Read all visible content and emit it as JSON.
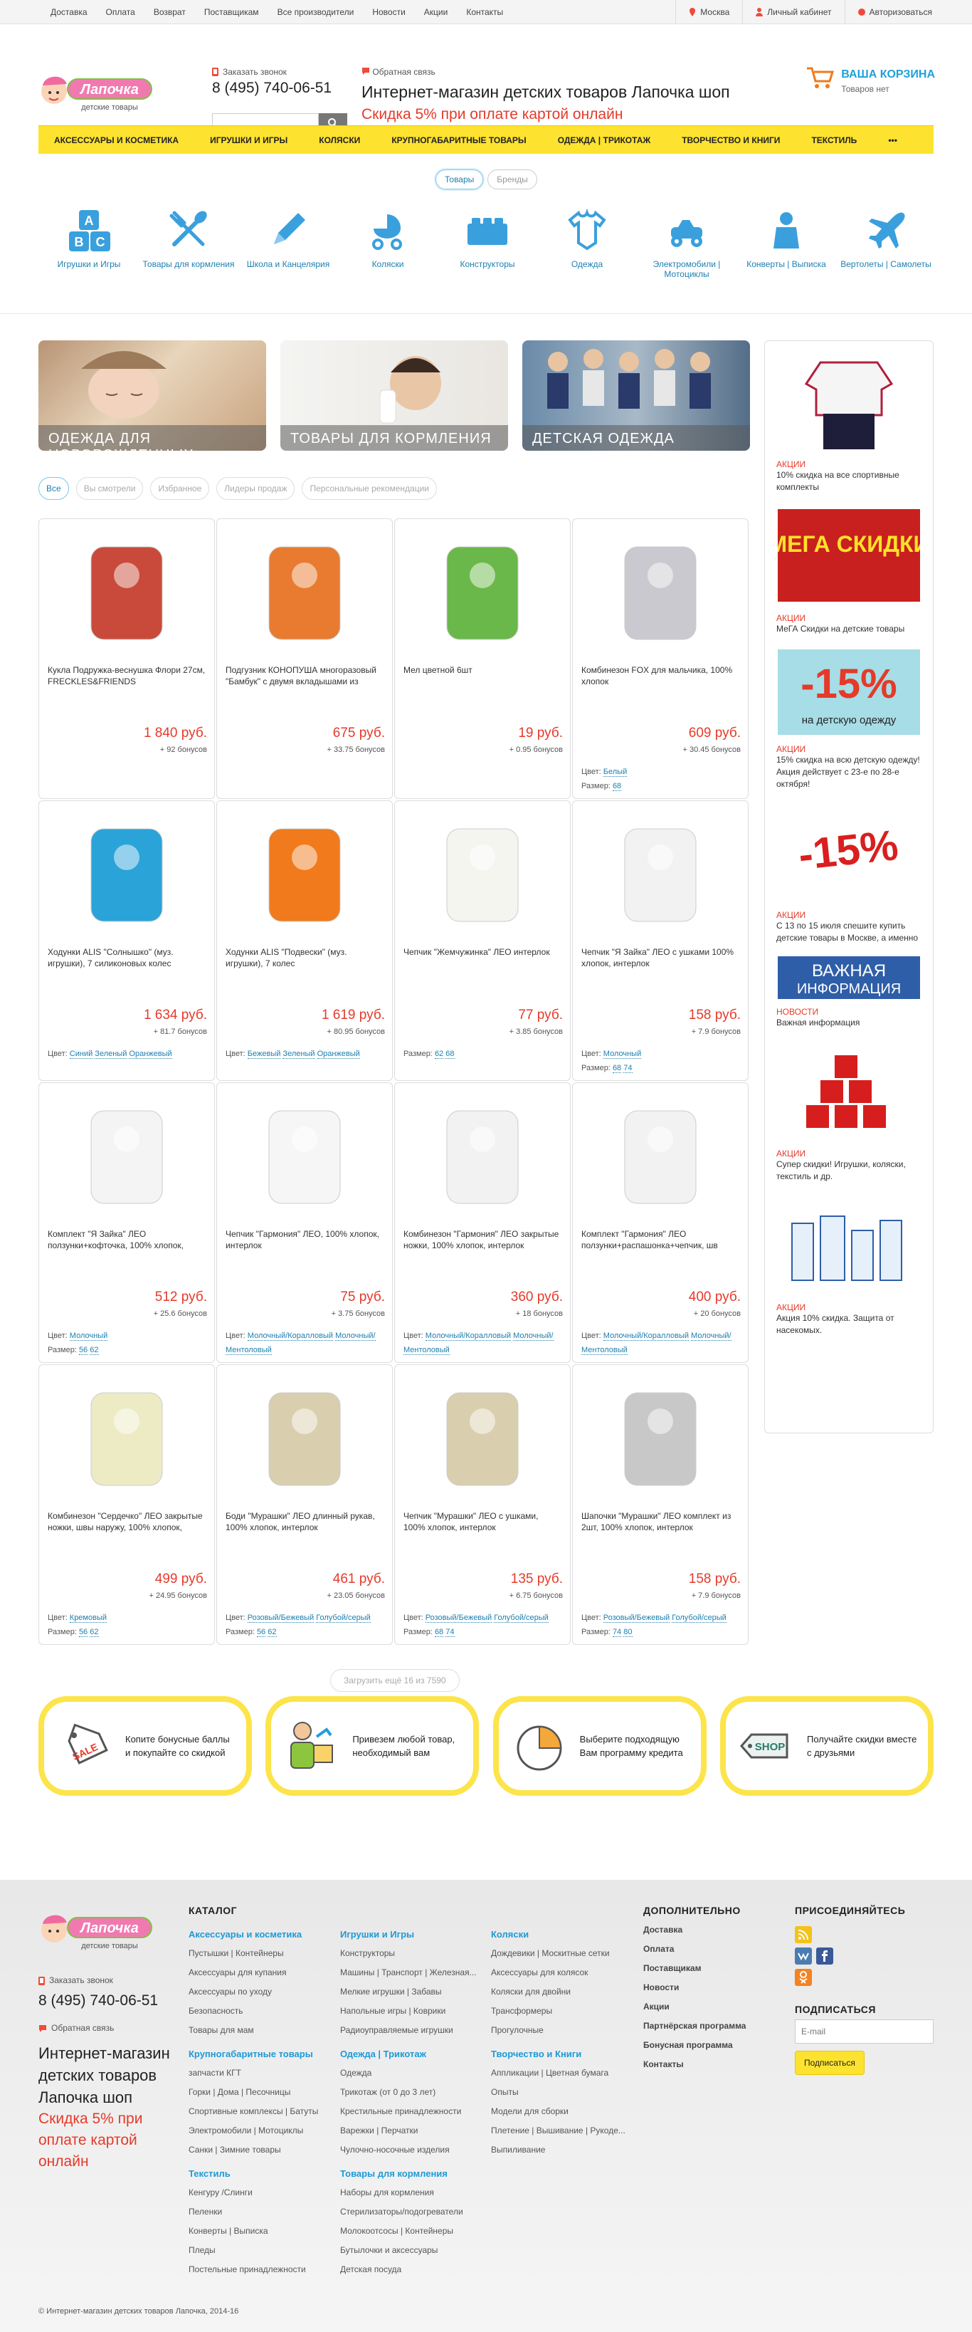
{
  "topnav": [
    "Доставка",
    "Оплата",
    "Возврат",
    "Поставщикам",
    "Все производители",
    "Новости",
    "Акции",
    "Контакты"
  ],
  "topright": {
    "city": "Москва",
    "cabinet": "Личный кабинет",
    "login": "Авторизоваться"
  },
  "header": {
    "callback": "Заказать звонок",
    "phone": "8 (495) 740-06-51",
    "feedback": "Обратная связь",
    "title": "Интернет-магазин детских товаров Лапочка шоп",
    "discount": "Скидка 5% при оплате картой онлайн",
    "logo": "Лапочка",
    "logo_sub": "детские товары",
    "cart_title": "ВАША КОРЗИНА",
    "cart_status": "Товаров нет"
  },
  "mainnav": [
    "Аксессуары и косметика",
    "Игрушки и игры",
    "Коляски",
    "Крупногабаритные товары",
    "Одежда | Трикотаж",
    "Творчество и книги",
    "Текстиль",
    "•••"
  ],
  "toggle": [
    "Товары",
    "Бренды"
  ],
  "categories": [
    "Игрушки и Игры",
    "Товары для кормления",
    "Школа и Канцелярия",
    "Коляски",
    "Конструкторы",
    "Одежда",
    "Электромобили | Мотоциклы",
    "Конверты | Выписка",
    "Вертолеты | Самолеты"
  ],
  "banners": [
    "Одежда для новорожденных",
    "Товары для кормления",
    "Детская одежда"
  ],
  "filters": [
    "Все",
    "Вы смотрели",
    "Избранное",
    "Лидеры продаж",
    "Персональные рекомендации"
  ],
  "products": [
    {
      "name": "Кукла Подружка-веснушка Флори 27см, FRECKLES&FRIENDS",
      "price": "1 840 руб.",
      "bonus": "+ 92 бонусов",
      "color": "#c94a3a"
    },
    {
      "name": "Подгузник КОНОПУША многоразовый \"Бамбук\" с двумя вкладышами из",
      "price": "675 руб.",
      "bonus": "+ 33.75 бонусов",
      "color": "#e87b30"
    },
    {
      "name": "Мел цветной 6шт",
      "price": "19 руб.",
      "bonus": "+ 0.95 бонусов",
      "color": "#6ab84a"
    },
    {
      "name": "Комбинезон FOX для мальчика, 100% хлопок",
      "price": "609 руб.",
      "bonus": "+ 30.45 бонусов",
      "color": "#c9c9cf",
      "cl": "Цвет:",
      "cv": [
        "Белый"
      ],
      "sl": "Размер:",
      "sv": [
        "68"
      ]
    },
    {
      "name": "Ходунки ALIS \"Солнышко\" (муз. игрушки), 7 силиконовых колес",
      "price": "1 634 руб.",
      "bonus": "+ 81.7 бонусов",
      "color": "#2aa3d9",
      "cl": "Цвет:",
      "cv": [
        "Синий",
        "Зеленый",
        "Оранжевый"
      ]
    },
    {
      "name": "Ходунки ALIS \"Подвески\" (муз. игрушки), 7 колес",
      "price": "1 619 руб.",
      "bonus": "+ 80.95 бонусов",
      "color": "#f07a1c",
      "cl": "Цвет:",
      "cv": [
        "Бежевый",
        "Зеленый",
        "Оранжевый"
      ]
    },
    {
      "name": "Чепчик \"Жемчужинка\" ЛЕО интерлок",
      "price": "77 руб.",
      "bonus": "+ 3.85 бонусов",
      "color": "#f5f5f0",
      "sl": "Размер:",
      "sv": [
        "62",
        "68"
      ]
    },
    {
      "name": "Чепчик \"Я Зайка\" ЛЕО с ушками 100% хлопок, интерлок",
      "price": "158 руб.",
      "bonus": "+ 7.9 бонусов",
      "color": "#f2f2f2",
      "cl": "Цвет:",
      "cv": [
        "Молочный"
      ],
      "sl": "Размер:",
      "sv": [
        "68",
        "74"
      ]
    },
    {
      "name": "Комплект \"Я Зайка\" ЛЕО ползунки+кофточка, 100% хлопок,",
      "price": "512 руб.",
      "bonus": "+ 25.6 бонусов",
      "color": "#f4f4f4",
      "cl": "Цвет:",
      "cv": [
        "Молочный"
      ],
      "sl": "Размер:",
      "sv": [
        "56",
        "62"
      ]
    },
    {
      "name": "Чепчик \"Гармония\" ЛЕО, 100% хлопок, интерлок",
      "price": "75 руб.",
      "bonus": "+ 3.75 бонусов",
      "color": "#f6f6f6",
      "cl": "Цвет:",
      "cv": [
        "Молочный/Коралловый",
        "Молочный/Ментоловый"
      ]
    },
    {
      "name": "Комбинезон \"Гармония\" ЛЕО закрытые ножки, 100% хлопок, интерлок",
      "price": "360 руб.",
      "bonus": "+ 18 бонусов",
      "color": "#f2f2f2",
      "cl": "Цвет:",
      "cv": [
        "Молочный/Коралловый",
        "Молочный/Ментоловый"
      ]
    },
    {
      "name": "Комплект \"Гармония\" ЛЕО ползунки+распашонка+чепчик, шв",
      "price": "400 руб.",
      "bonus": "+ 20 бонусов",
      "color": "#f2f2f2",
      "cl": "Цвет:",
      "cv": [
        "Молочный/Коралловый",
        "Молочный/Ментоловый"
      ]
    },
    {
      "name": "Комбинезон \"Сердечко\" ЛЕО закрытые ножки, швы наружу, 100% хлопок,",
      "price": "499 руб.",
      "bonus": "+ 24.95 бонусов",
      "color": "#ecebc4",
      "cl": "Цвет:",
      "cv": [
        "Кремовый"
      ],
      "sl": "Размер:",
      "sv": [
        "56",
        "62"
      ]
    },
    {
      "name": "Боди \"Мурашки\" ЛЕО длинный рукав, 100% хлопок, интерлок",
      "price": "461 руб.",
      "bonus": "+ 23.05 бонусов",
      "color": "#d9cfae",
      "cl": "Цвет:",
      "cv": [
        "Розовый/Бежевый",
        "Голубой/серый"
      ],
      "sl": "Размер:",
      "sv": [
        "56",
        "62"
      ]
    },
    {
      "name": "Чепчик \"Мурашки\" ЛЕО с ушками, 100% хлопок, интерлок",
      "price": "135 руб.",
      "bonus": "+ 6.75 бонусов",
      "color": "#d9cfae",
      "cl": "Цвет:",
      "cv": [
        "Розовый/Бежевый",
        "Голубой/серый"
      ],
      "sl": "Размер:",
      "sv": [
        "68",
        "74"
      ]
    },
    {
      "name": "Шапочки \"Мурашки\" ЛЕО комплект из 2шт, 100% хлопок, интерлок",
      "price": "158 руб.",
      "bonus": "+ 7.9 бонусов",
      "color": "#c8c8c8",
      "cl": "Цвет:",
      "cv": [
        "Розовый/Бежевый",
        "Голубой/серый"
      ],
      "sl": "Размер:",
      "sv": [
        "74",
        "80"
      ]
    }
  ],
  "load_more": "Загрузить ещё 16 из 7590",
  "sidebar": [
    {
      "type": "Акции",
      "text": "10% скидка на все спортивные комплекты"
    },
    {
      "type": "Акции",
      "text": "МеГА Скидки на детские товары",
      "img": "МЕГА СКИДКИ"
    },
    {
      "type": "Акции",
      "text": "15% скидка на всю детскую одежду! Акция действует с 23-е по 28-е октября!",
      "img": "-15%",
      "img2": "на детскую одежду"
    },
    {
      "type": "Акции",
      "text": "С 13 по 15 июля спешите купить детские товары в Москве, а именно",
      "img": "-15%"
    },
    {
      "type": "Новости",
      "text": "Важная информация",
      "img": "ВАЖНАЯ",
      "img2": "ИНФОРМАЦИЯ"
    },
    {
      "type": "Акции",
      "text": "Супер скидки! Игрушки, коляски, текстиль и др."
    },
    {
      "type": "Акции",
      "text": "Акция 10% скидка. Защита от насекомых."
    }
  ],
  "features": [
    "Копите бонусные баллы и покупайте со скидкой",
    "Привезем любой товар, необходимый вам",
    "Выберите подходящую Вам программу кредита",
    "Получайте скидки вместе с друзьями"
  ],
  "feature_icon_text": [
    "SALE",
    "SHOP"
  ],
  "footer": {
    "catalog_title": "Каталог",
    "col1": [
      {
        "h": "Аксессуары и косметика",
        "items": [
          "Пустышки | Контейнеры",
          "Аксессуары для купания",
          "Аксессуары по уходу",
          "Безопасность",
          "Товары для мам"
        ]
      },
      {
        "h": "Крупногабаритные товары",
        "items": [
          "запчасти КГТ",
          "Горки | Дома | Песочницы",
          "Спортивные комплексы | Батуты",
          "Электромобили | Мотоциклы",
          "Санки | Зимние товары"
        ]
      },
      {
        "h": "Текстиль",
        "items": [
          "Кенгуру /Слинги",
          "Пеленки",
          "Конверты | Выписка",
          "Пледы",
          "Постельные принадлежности"
        ]
      }
    ],
    "col2": [
      {
        "h": "Игрушки и Игры",
        "items": [
          "Конструкторы",
          "Машины | Транспорт | Железная...",
          "Мелкие игрушки | Забавы",
          "Напольные игры | Коврики",
          "Радиоуправляемые игрушки"
        ]
      },
      {
        "h": "Одежда | Трикотаж",
        "items": [
          "Одежда",
          "Трикотаж (от 0 до 3 лет)",
          "Крестильные принадлежности",
          "Варежки | Перчатки",
          "Чулочно-носочные изделия"
        ]
      },
      {
        "h": "Товары для кормления",
        "items": [
          "Наборы для кормления",
          "Стерилизаторы/подогреватели",
          "Молокоотсосы | Контейнеры",
          "Бутылочки и аксессуары",
          "Детская посуда"
        ]
      }
    ],
    "col3": [
      {
        "h": "Коляски",
        "items": [
          "Дождевики | Москитные сетки",
          "Аксессуары для колясок",
          "Коляски для двойни",
          "Трансформеры",
          "Прогулочные"
        ]
      },
      {
        "h": "Творчество и Книги",
        "items": [
          "Аппликации | Цветная бумага",
          "Опыты",
          "Модели для сборки",
          "Плетение | Вышивание | Рукоде...",
          "Выпиливание"
        ]
      }
    ],
    "extra_title": "Дополнительно",
    "extra": [
      "Доставка",
      "Оплата",
      "Поставщикам",
      "Новости",
      "Акции",
      "Партнёрская программа",
      "Бонусная программа",
      "Контакты"
    ],
    "join_title": "Присоединяйтесь",
    "subscribe_title": "Подписаться",
    "email_placeholder": "E-mail",
    "subscribe_btn": "Подписаться",
    "copyright": "© Интернет-магазин детских товаров Лапочка, 2014-16"
  },
  "colors": {
    "accent": "#fde32f",
    "link": "#1e7fb0",
    "price": "#e53a2a"
  }
}
